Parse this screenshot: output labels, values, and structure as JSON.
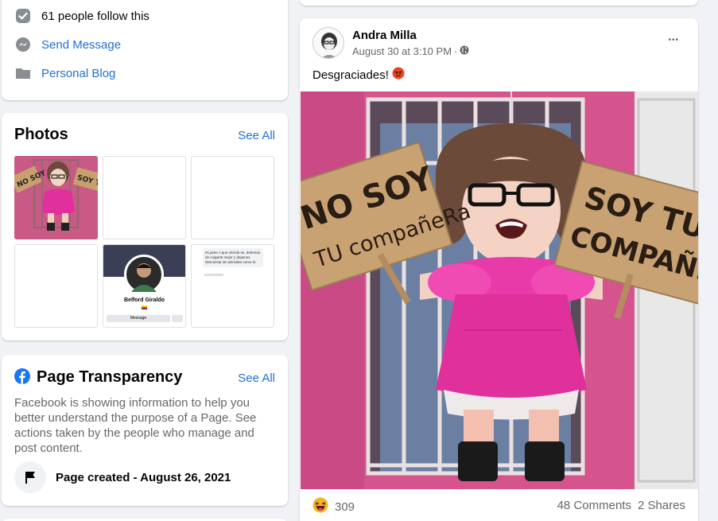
{
  "about": {
    "followers": "61 people follow this",
    "send_message": "Send Message",
    "blog": "Personal Blog"
  },
  "photos": {
    "title": "Photos",
    "see_all": "See All",
    "thumb_sign_left": "NO SOY",
    "thumb_sign_right": "SOY TU",
    "profile_name": "Belford Giraldo",
    "profile_button": "Message",
    "text_snippet": "es jame o que mierda es, deberías de colgarte mejor y dejamos descansar de animales como tú"
  },
  "transparency": {
    "title": "Page Transparency",
    "see_all": "See All",
    "description": "Facebook is showing information to help you better understand the purpose of a Page. See actions taken by the people who manage and post content.",
    "created": "Page created - August 26, 2021"
  },
  "post": {
    "author": "Andra Milla",
    "timestamp": "August 30 at 3:10 PM",
    "separator": "·",
    "more": "•••",
    "text": "Desgraciades!",
    "image": {
      "sign_left_line1": "NO SOY",
      "sign_left_line2": "TU compañeRa",
      "sign_right_line1": "SOY TU",
      "sign_right_line2": "COMPAÑER"
    },
    "reactions_count": "309",
    "comments": "48 Comments",
    "shares": "2 Shares"
  },
  "colors": {
    "background": "#f0f2f5",
    "link": "#216fdb",
    "facebook_blue": "#1877f2",
    "wall_pink": "#d6548e",
    "dress_pink": "#e0309b"
  }
}
